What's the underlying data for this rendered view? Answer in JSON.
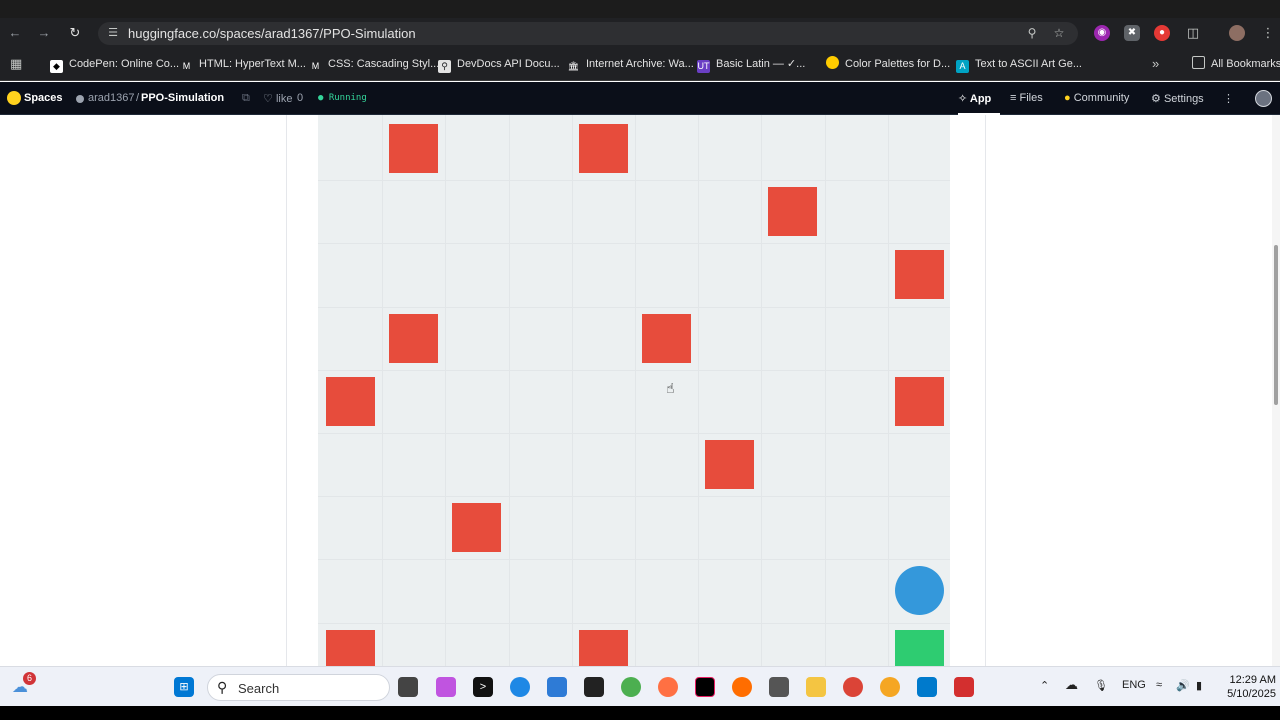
{
  "browser": {
    "url": "huggingface.co/spaces/arad1367/PPO-Simulation",
    "bookmarks": [
      {
        "label": "CodePen: Online Co...",
        "icon": "codepen-icon",
        "color": "#ffffff"
      },
      {
        "label": "HTML: HyperText M...",
        "icon": "mdn-icon",
        "color": "#ffffff"
      },
      {
        "label": "CSS: Cascading Styl...",
        "icon": "mdn-icon",
        "color": "#ffffff"
      },
      {
        "label": "DevDocs API Docu...",
        "icon": "devdocs-icon",
        "color": "#ffffff"
      },
      {
        "label": "Internet Archive: Wa...",
        "icon": "archive-icon",
        "color": "#ffffff"
      },
      {
        "label": "Basic Latin — ✓...",
        "icon": "ut-icon",
        "color": "#6a3fc4"
      },
      {
        "label": "Color Palettes for D...",
        "icon": "palette-icon",
        "color": "#ffcc00"
      },
      {
        "label": "Text to ASCII Art Ge...",
        "icon": "ascii-icon",
        "color": "#00a3c4"
      }
    ],
    "all_bookmarks": "All Bookmarks"
  },
  "hf": {
    "spaces": "Spaces",
    "owner": "arad1367",
    "repo": "PPO-Simulation",
    "like": "like",
    "like_count": "0",
    "status": "Running",
    "nav": {
      "app": "App",
      "files": "Files",
      "community": "Community",
      "settings": "Settings"
    }
  },
  "grid": {
    "obstacles": [
      [
        1,
        0
      ],
      [
        4,
        0
      ],
      [
        7,
        1
      ],
      [
        9,
        2
      ],
      [
        1,
        3
      ],
      [
        5,
        3
      ],
      [
        0,
        4
      ],
      [
        9,
        4
      ],
      [
        6,
        5
      ],
      [
        2,
        6
      ],
      [
        0,
        8
      ],
      [
        4,
        8
      ]
    ],
    "agent": [
      9,
      7
    ],
    "goal": [
      9,
      8
    ],
    "colors": {
      "obstacle": "#e74c3c",
      "agent": "#3498db",
      "goal": "#2ecc71",
      "board": "#ecf0f1"
    }
  },
  "taskbar": {
    "search": "Search",
    "notification_count": "6",
    "lang": "ENG",
    "time": "12:29 AM",
    "date": "5/10/2025"
  }
}
